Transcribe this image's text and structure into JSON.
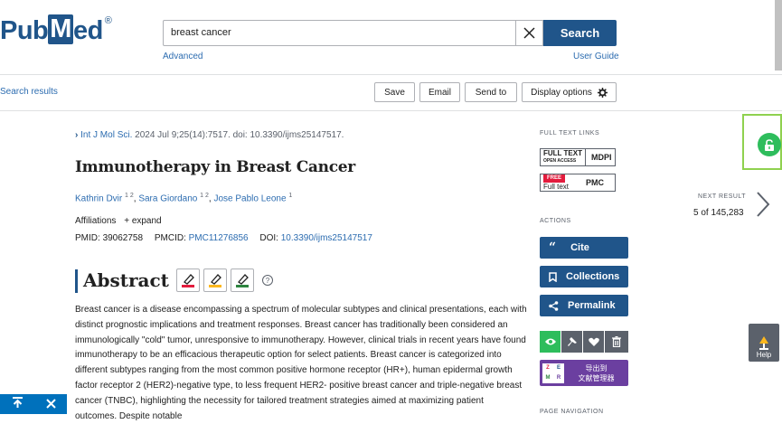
{
  "header": {
    "logo_text": "PubMed",
    "logo_pre": "Pub",
    "logo_post": "ed",
    "logo_mark": "M",
    "registered": "®",
    "search_value": "breast cancer",
    "search_button": "Search",
    "advanced_link": "Advanced",
    "user_guide_link": "User Guide"
  },
  "toolbar": {
    "back_link": "Search results",
    "save": "Save",
    "email": "Email",
    "send_to": "Send to",
    "display_options": "Display options"
  },
  "article": {
    "journal": "Int J Mol Sci.",
    "citation": " 2024 Jul 9;25(14):7517. doi: 10.3390/ijms25147517.",
    "title": "Immunotherapy in Breast Cancer",
    "authors": [
      {
        "name": "Kathrin Dvir",
        "sup": "1 2"
      },
      {
        "name": "Sara Giordano",
        "sup": "1 2"
      },
      {
        "name": "Jose Pablo Leone",
        "sup": "1"
      }
    ],
    "affiliations_label": "Affiliations",
    "expand_label": "expand",
    "pmid_label": "PMID:",
    "pmid": "39062758",
    "pmcid_label": "PMCID:",
    "pmcid": "PMC11276856",
    "doi_label": "DOI:",
    "doi": "10.3390/ijms25147517",
    "abstract_title": "Abstract",
    "help_glyph": "?",
    "abstract_text": "Breast cancer is a disease encompassing a spectrum of molecular subtypes and clinical presentations, each with distinct prognostic implications and treatment responses. Breast cancer has traditionally been considered an immunologically \"cold\" tumor, unresponsive to immunotherapy. However, clinical trials in recent years have found immunotherapy to be an efficacious therapeutic option for select patients. Breast cancer is categorized into different subtypes ranging from the most common positive hormone receptor (HR+), human epidermal growth factor receptor 2 (HER2)-negative type, to less frequent HER2- positive breast cancer and triple-negative breast cancer (TNBC), highlighting the necessity for tailored treatment strategies aimed at maximizing patient outcomes. Despite notable"
  },
  "sidebar": {
    "full_text_links_label": "FULL TEXT LINKS",
    "mdpi_badge_line1": "FULL TEXT",
    "mdpi_badge_line2": "OPEN ACCESS",
    "mdpi_badge_brand": "MDPI",
    "pmc_badge_line1": "FREE",
    "pmc_badge_line2": "Full text",
    "pmc_badge_brand": "PMC",
    "actions_label": "ACTIONS",
    "cite": "Cite",
    "collections": "Collections",
    "permalink": "Permalink",
    "export_label_1": "导出到",
    "export_label_2": "文献管理器",
    "page_navigation_label": "PAGE NAVIGATION"
  },
  "next_result": {
    "label": "NEXT RESULT",
    "position": "5 of 145,283"
  },
  "help_widget": {
    "label": "Help"
  },
  "colors": {
    "brand": "#20558a",
    "link": "#2c6cb0",
    "open_access": "#2ebd5c",
    "highlight_box": "#8fd14f",
    "scroll_top_bar": "#0071bc",
    "export_purple": "#6b3fa0"
  }
}
